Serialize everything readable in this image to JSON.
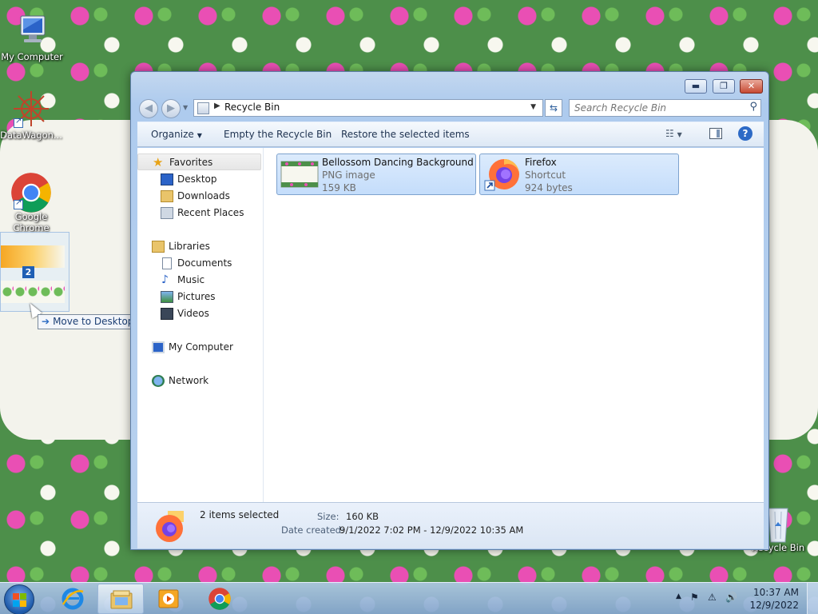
{
  "desktop": {
    "icons": [
      {
        "label": "My Computer",
        "icon": "computer-icon"
      },
      {
        "label": "DataWagon...",
        "icon": "datawagon-icon"
      },
      {
        "label": "Google Chrome",
        "icon": "chrome-icon"
      },
      {
        "label": "Recycle Bin",
        "icon": "recycle-bin-icon"
      }
    ],
    "drag": {
      "count": "2",
      "tooltip": "Move to Desktop"
    }
  },
  "window": {
    "title": "Recycle Bin",
    "controls": {
      "minimize": "▬",
      "maximize": "❐",
      "close": "✕"
    },
    "address": {
      "breadcrumb": "Recycle Bin"
    },
    "search": {
      "placeholder": "Search Recycle Bin"
    },
    "toolbar": {
      "organize": "Organize",
      "empty": "Empty the Recycle Bin",
      "restore": "Restore the selected items"
    },
    "nav": {
      "favorites": "Favorites",
      "desktop": "Desktop",
      "downloads": "Downloads",
      "recent": "Recent Places",
      "libraries": "Libraries",
      "documents": "Documents",
      "music": "Music",
      "pictures": "Pictures",
      "videos": "Videos",
      "computer": "My Computer",
      "network": "Network"
    },
    "files": [
      {
        "name": "Bellossom Dancing Background",
        "type": "PNG image",
        "size": "159 KB"
      },
      {
        "name": "Firefox",
        "type": "Shortcut",
        "size": "924 bytes"
      }
    ],
    "details": {
      "count": "2 items selected",
      "size_label": "Size:",
      "size_value": "160 KB",
      "date_label": "Date created:",
      "date_value": "9/1/2022 7:02 PM - 12/9/2022 10:35 AM"
    }
  },
  "taskbar": {
    "apps": [
      "internet-explorer-icon",
      "explorer-folder-icon",
      "media-player-icon",
      "chrome-icon"
    ],
    "time": "10:37 AM",
    "date": "12/9/2022"
  },
  "colors": {
    "accent": "#2d6ac6",
    "selection": "#c4ddfb",
    "wallpaper_green": "#4d8f4a",
    "wallpaper_pink": "#e94fb4"
  }
}
